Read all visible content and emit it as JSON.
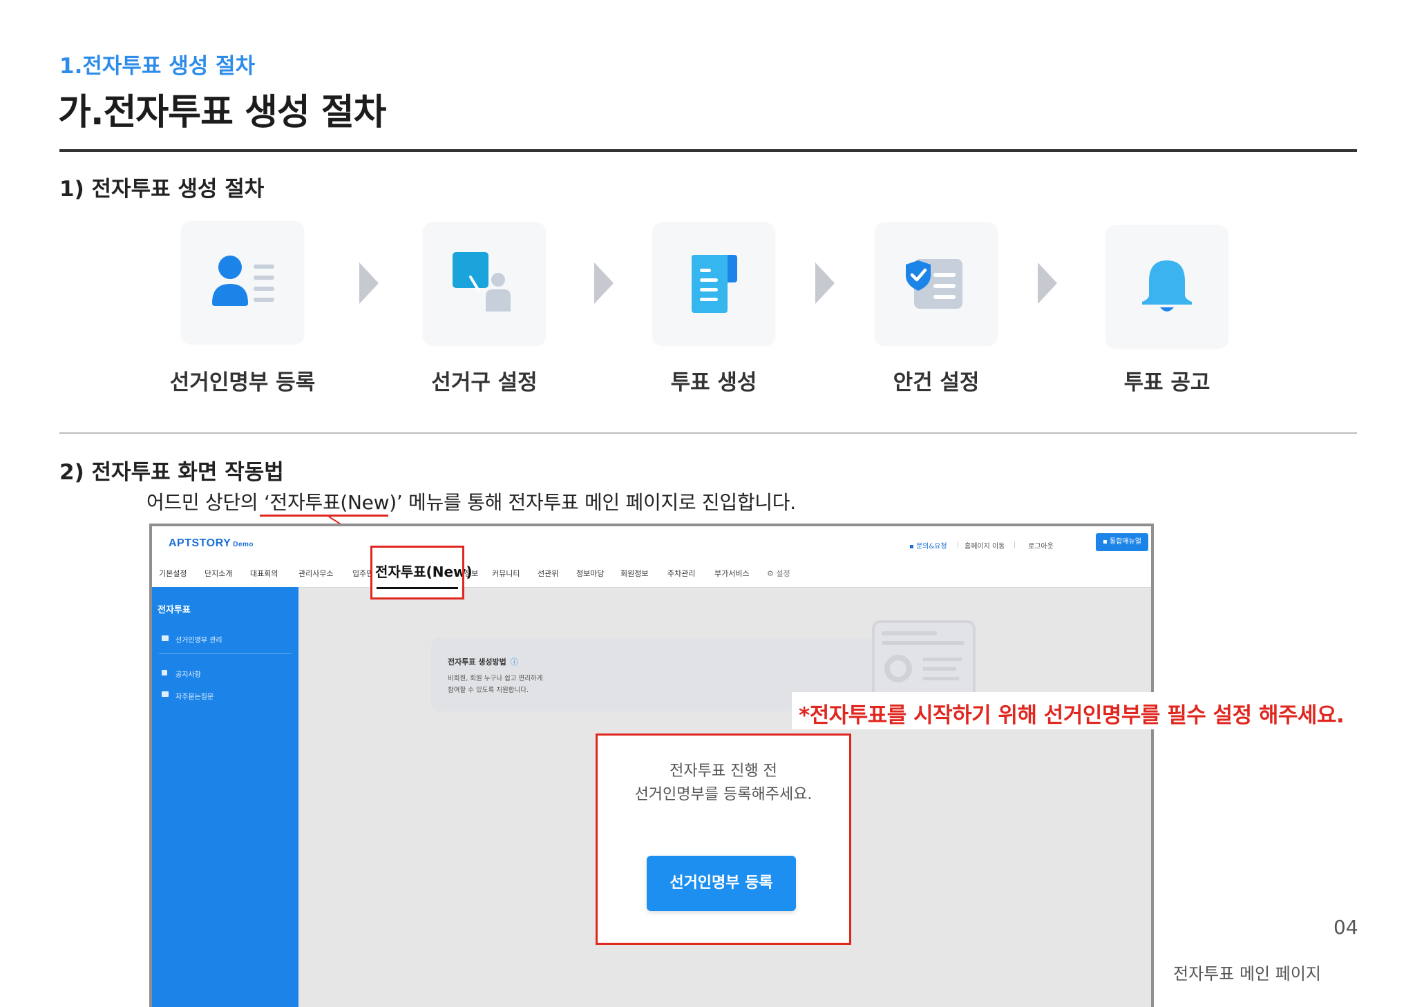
{
  "header": {
    "chapter": "1.전자투표 생성 절차",
    "title": "가.전자투표 생성 절차"
  },
  "section1": {
    "title": "1) 전자투표 생성 절차",
    "steps": [
      {
        "label": "선거인명부 등록",
        "icon": "voter-list-icon"
      },
      {
        "label": "선거구 설정",
        "icon": "presentation-icon"
      },
      {
        "label": "투표 생성",
        "icon": "document-icon"
      },
      {
        "label": "안건 설정",
        "icon": "checklist-icon"
      },
      {
        "label": "투표 공고",
        "icon": "bell-icon"
      }
    ]
  },
  "section2": {
    "title": "2) 전자투표 화면 작동법",
    "instruction": "어드민 상단의 ‘전자투표(New)’ 메뉴를 통해 전자투표 메인 페이지로 진입합니다."
  },
  "screenshot": {
    "logo": "APTSTORY",
    "logo_sub": "Demo",
    "util": {
      "inquiry": "문의&요청",
      "homepage": "홈페이지 이동",
      "logout": "로그아웃",
      "manual": "통합매뉴얼"
    },
    "menu": [
      "기본설정",
      "단지소개",
      "대표회의",
      "관리사무소",
      "입주민",
      "정보",
      "커뮤니티",
      "선관위",
      "정보마당",
      "회원정보",
      "주차관리",
      "부가서비스",
      "설정"
    ],
    "active_tab": "전자투표(New)",
    "sidebar": {
      "title": "전자투표",
      "items": [
        "선거인명부 관리",
        "공지사항",
        "자주묻는질문"
      ]
    },
    "info": {
      "title": "전자투표 생성방법",
      "desc1": "비회원, 회원 누구나 쉽고 편리하게",
      "desc2": "참여할 수 있도록 지원합니다."
    },
    "notice": {
      "line1": "전자투표 진행 전",
      "line2": "선거인명부를 등록해주세요.",
      "button": "선거인명부 등록"
    }
  },
  "warning": "*전자투표를 시작하기 위해 선거인명부를 필수 설정 해주세요.",
  "footer": {
    "page": "04",
    "caption": "전자투표 메인 페이지"
  },
  "colors": {
    "accent": "#2d8cea",
    "sidebar": "#1c84e8",
    "highlight": "#e0271f"
  }
}
